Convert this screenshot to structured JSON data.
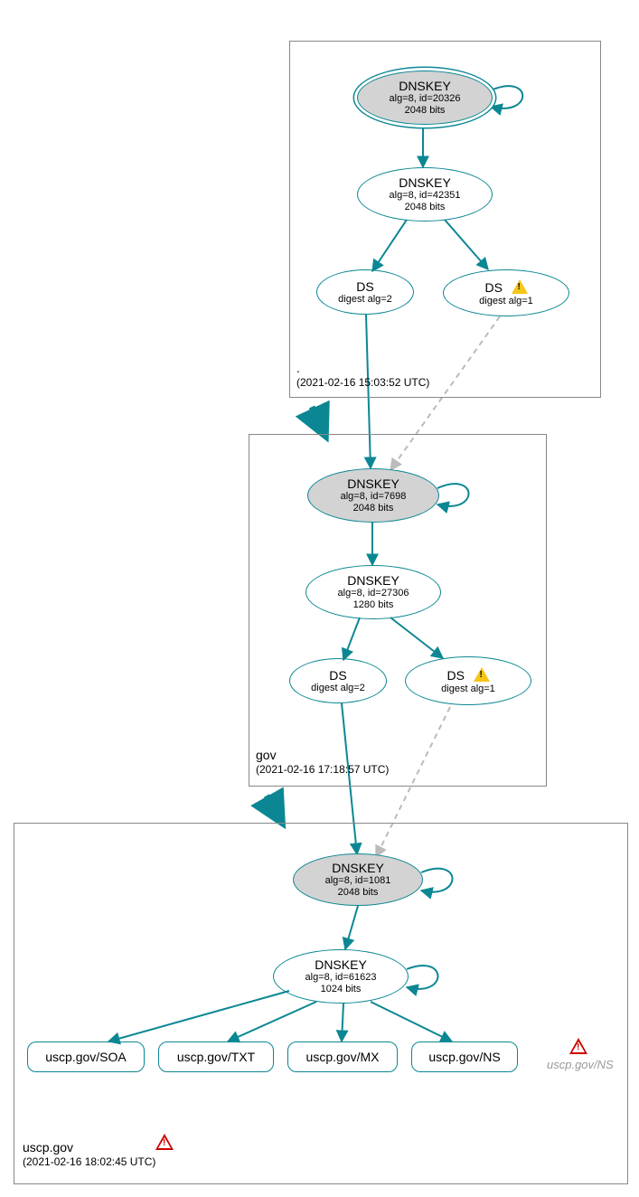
{
  "zones": {
    "root": {
      "title": ".",
      "timestamp": "(2021-02-16 15:03:52 UTC)"
    },
    "gov": {
      "title": "gov",
      "timestamp": "(2021-02-16 17:18:57 UTC)"
    },
    "uscp": {
      "title": "uscp.gov",
      "timestamp": "(2021-02-16 18:02:45 UTC)"
    }
  },
  "nodes": {
    "root_ksk": {
      "t1": "DNSKEY",
      "t2": "alg=8, id=20326",
      "t3": "2048 bits"
    },
    "root_zsk": {
      "t1": "DNSKEY",
      "t2": "alg=8, id=42351",
      "t3": "2048 bits"
    },
    "root_ds2": {
      "t1": "DS",
      "t2": "digest alg=2"
    },
    "root_ds1": {
      "t1": "DS",
      "t2": "digest alg=1"
    },
    "gov_ksk": {
      "t1": "DNSKEY",
      "t2": "alg=8, id=7698",
      "t3": "2048 bits"
    },
    "gov_zsk": {
      "t1": "DNSKEY",
      "t2": "alg=8, id=27306",
      "t3": "1280 bits"
    },
    "gov_ds2": {
      "t1": "DS",
      "t2": "digest alg=2"
    },
    "gov_ds1": {
      "t1": "DS",
      "t2": "digest alg=1"
    },
    "uscp_ksk": {
      "t1": "DNSKEY",
      "t2": "alg=8, id=1081",
      "t3": "2048 bits"
    },
    "uscp_zsk": {
      "t1": "DNSKEY",
      "t2": "alg=8, id=61623",
      "t3": "1024 bits"
    }
  },
  "rrsets": {
    "soa": "uscp.gov/SOA",
    "txt": "uscp.gov/TXT",
    "mx": "uscp.gov/MX",
    "ns": "uscp.gov/NS",
    "ns_err": "uscp.gov/NS"
  }
}
